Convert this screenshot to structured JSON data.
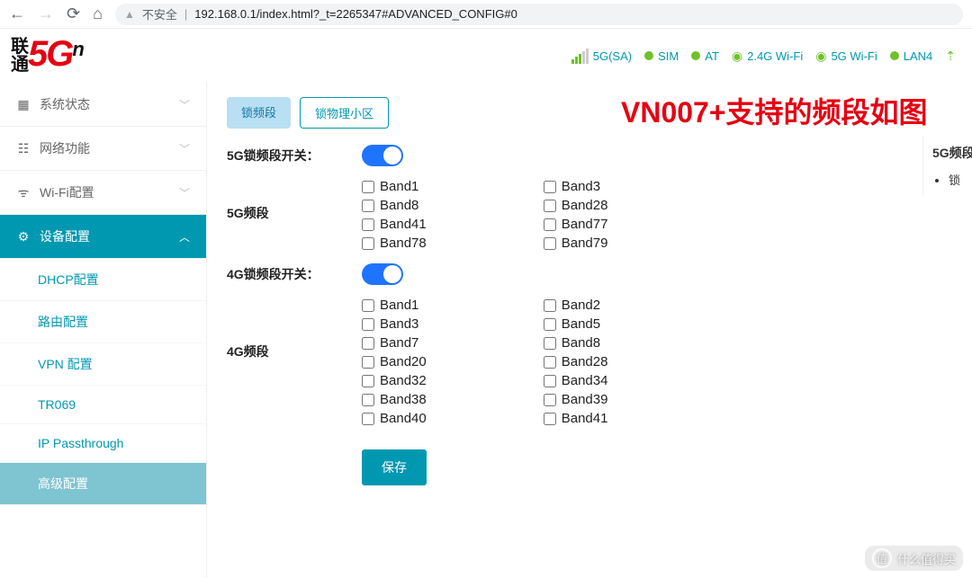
{
  "browser": {
    "insecure_label": "不安全",
    "url": "192.168.0.1/index.html?_t=2265347#ADVANCED_CONFIG#0"
  },
  "logo": {
    "cn_lines": "联\n通",
    "fiveG": "5G",
    "sup": "n"
  },
  "status": {
    "sig": "5G(SA)",
    "sim": "SIM",
    "at": "AT",
    "w24": "2.4G Wi-Fi",
    "w5": "5G Wi-Fi",
    "lan": "LAN4"
  },
  "sidebar": {
    "items": [
      {
        "label": "系统状态",
        "icon": "dashboard-icon"
      },
      {
        "label": "网络功能",
        "icon": "network-icon"
      },
      {
        "label": "Wi-Fi配置",
        "icon": "wifi-icon"
      },
      {
        "label": "设备配置",
        "icon": "gear-icon"
      }
    ],
    "subs": [
      {
        "label": "DHCP配置"
      },
      {
        "label": "路由配置"
      },
      {
        "label": "VPN 配置"
      },
      {
        "label": "TR069"
      },
      {
        "label": "IP Passthrough"
      },
      {
        "label": "高级配置"
      }
    ]
  },
  "tabs": {
    "t1": "锁频段",
    "t2": "锁物理小区"
  },
  "annotation": "VN007+支持的频段如图",
  "form": {
    "toggle5g_label": "5G锁频段开关：",
    "bands5g_label": "5G频段",
    "toggle4g_label": "4G锁频段开关：",
    "bands4g_label": "4G频段",
    "bands5g_col1": [
      "Band1",
      "Band8",
      "Band41",
      "Band78"
    ],
    "bands5g_col2": [
      "Band3",
      "Band28",
      "Band77",
      "Band79"
    ],
    "bands4g_col1": [
      "Band1",
      "Band3",
      "Band7",
      "Band20",
      "Band32",
      "Band38",
      "Band40"
    ],
    "bands4g_col2": [
      "Band2",
      "Band5",
      "Band8",
      "Band28",
      "Band34",
      "Band39",
      "Band41"
    ],
    "save": "保存"
  },
  "sideinfo": {
    "heading": "5G频段",
    "bullet": "锁"
  },
  "watermark": {
    "glyph": "值",
    "text": "什么值得买"
  }
}
